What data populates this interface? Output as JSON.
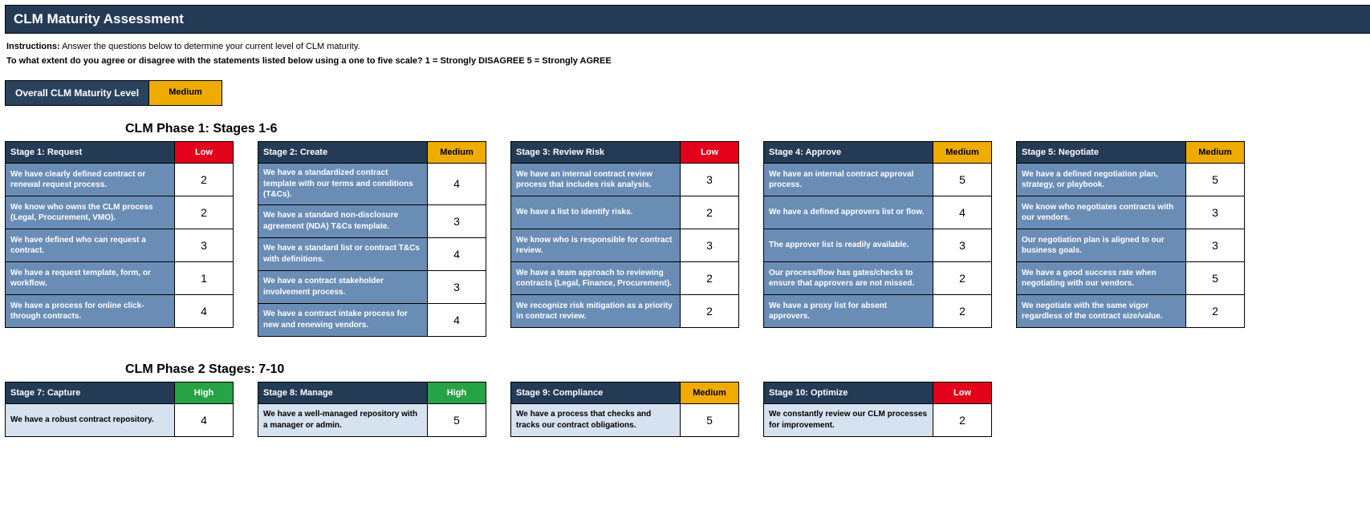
{
  "title": "CLM Maturity Assessment",
  "instructions_label": "Instructions:",
  "instructions_text": "  Answer the questions below to determine your current level of CLM maturity.",
  "scale_question": "To what extent do you agree or disagree with the statements listed below using a one to five scale?    1 = Strongly DISAGREE      5 = Strongly AGREE",
  "overall_label": "Overall CLM Maturity Level",
  "overall_level": "Medium",
  "phase1_title": "CLM Phase 1: Stages 1-6",
  "phase2_title": "CLM Phase 2 Stages: 7-10",
  "levels": {
    "Low": "badge-low",
    "Medium": "badge-medium",
    "High": "badge-high"
  },
  "phase1": [
    {
      "name": "Stage 1: Request",
      "level": "Low",
      "shade": "bg-blue",
      "rows": [
        {
          "t": "We have clearly defined contract or renewal request process.",
          "v": 2
        },
        {
          "t": "We know who owns the CLM process (Legal, Procurement, VMO).",
          "v": 2
        },
        {
          "t": "We have defined who can request a contract.",
          "v": 3
        },
        {
          "t": "We have a request template, form, or workflow.",
          "v": 1
        },
        {
          "t": "We have a process for online click-through contracts.",
          "v": 4
        }
      ]
    },
    {
      "name": "Stage 2: Create",
      "level": "Medium",
      "shade": "bg-blue",
      "rows": [
        {
          "t": "We have a standardized contract template with our terms and conditions (T&Cs).",
          "v": 4
        },
        {
          "t": "We have a standard non-disclosure agreement (NDA) T&Cs template.",
          "v": 3
        },
        {
          "t": "We have a standard list or contract T&Cs with definitions.",
          "v": 4
        },
        {
          "t": "We have a contract stakeholder involvement process.",
          "v": 3
        },
        {
          "t": "We have a contract intake process for new and renewing vendors.",
          "v": 4
        }
      ]
    },
    {
      "name": "Stage 3: Review Risk",
      "level": "Low",
      "shade": "bg-blue",
      "rows": [
        {
          "t": "We have an internal contract review process that includes risk analysis.",
          "v": 3
        },
        {
          "t": "We have a list to identify risks.",
          "v": 2
        },
        {
          "t": "We know who is responsible for contract review.",
          "v": 3
        },
        {
          "t": "We have a team approach to reviewing contracts (Legal, Finance, Procurement).",
          "v": 2
        },
        {
          "t": "We recognize risk mitigation as a priority in contract review.",
          "v": 2
        }
      ]
    },
    {
      "name": "Stage 4: Approve",
      "level": "Medium",
      "shade": "bg-blue",
      "rows": [
        {
          "t": "We have an internal contract approval process.",
          "v": 5
        },
        {
          "t": "We have a defined approvers list or flow.",
          "v": 4
        },
        {
          "t": "The approver list is readily available.",
          "v": 3
        },
        {
          "t": "Our process/flow has gates/checks to ensure that approvers are not missed.",
          "v": 2
        },
        {
          "t": "We have a proxy list for absent approvers.",
          "v": 2
        }
      ]
    },
    {
      "name": "Stage 5: Negotiate",
      "level": "Medium",
      "shade": "bg-blue",
      "rows": [
        {
          "t": "We have a defined negotiation plan, strategy, or playbook.",
          "v": 5
        },
        {
          "t": "We know who negotiates contracts with our vendors.",
          "v": 3
        },
        {
          "t": "Our negotiation plan is aligned to our business goals.",
          "v": 3
        },
        {
          "t": "We have a good success rate when negotiating with our vendors.",
          "v": 5
        },
        {
          "t": "We negotiate with the same vigor regardless of the contract size/value.",
          "v": 2
        }
      ]
    }
  ],
  "phase2": [
    {
      "name": "Stage 7: Capture",
      "level": "High",
      "shade": "bg-lblue",
      "rows": [
        {
          "t": "We have a robust contract repository.",
          "v": 4
        }
      ]
    },
    {
      "name": "Stage 8: Manage",
      "level": "High",
      "shade": "bg-lblue",
      "rows": [
        {
          "t": "We have a well-managed repository with a manager or admin.",
          "v": 5
        }
      ]
    },
    {
      "name": "Stage 9: Compliance",
      "level": "Medium",
      "shade": "bg-lblue",
      "rows": [
        {
          "t": "We have a process that checks and tracks our contract obligations.",
          "v": 5
        }
      ]
    },
    {
      "name": "Stage 10: Optimize",
      "level": "Low",
      "shade": "bg-lblue",
      "rows": [
        {
          "t": "We constantly review our CLM processes for improvement.",
          "v": 2
        }
      ]
    }
  ]
}
